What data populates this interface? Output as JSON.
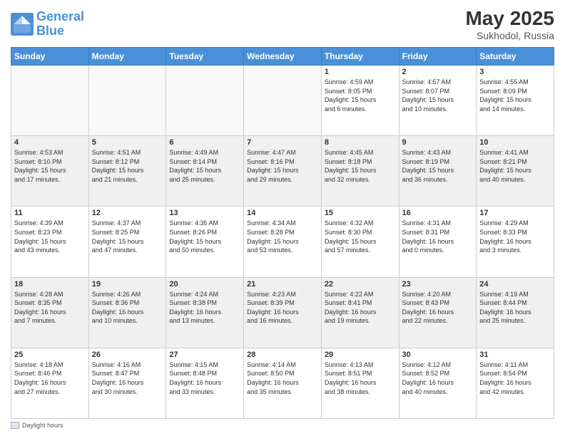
{
  "header": {
    "logo_line1": "General",
    "logo_line2": "Blue",
    "title": "May 2025",
    "subtitle": "Sukhodol, Russia"
  },
  "footer": {
    "label": "Daylight hours"
  },
  "weekdays": [
    "Sunday",
    "Monday",
    "Tuesday",
    "Wednesday",
    "Thursday",
    "Friday",
    "Saturday"
  ],
  "weeks": [
    [
      {
        "day": "",
        "info": ""
      },
      {
        "day": "",
        "info": ""
      },
      {
        "day": "",
        "info": ""
      },
      {
        "day": "",
        "info": ""
      },
      {
        "day": "1",
        "info": "Sunrise: 4:59 AM\nSunset: 8:05 PM\nDaylight: 15 hours\nand 6 minutes."
      },
      {
        "day": "2",
        "info": "Sunrise: 4:57 AM\nSunset: 8:07 PM\nDaylight: 15 hours\nand 10 minutes."
      },
      {
        "day": "3",
        "info": "Sunrise: 4:55 AM\nSunset: 8:09 PM\nDaylight: 15 hours\nand 14 minutes."
      }
    ],
    [
      {
        "day": "4",
        "info": "Sunrise: 4:53 AM\nSunset: 8:10 PM\nDaylight: 15 hours\nand 17 minutes."
      },
      {
        "day": "5",
        "info": "Sunrise: 4:51 AM\nSunset: 8:12 PM\nDaylight: 15 hours\nand 21 minutes."
      },
      {
        "day": "6",
        "info": "Sunrise: 4:49 AM\nSunset: 8:14 PM\nDaylight: 15 hours\nand 25 minutes."
      },
      {
        "day": "7",
        "info": "Sunrise: 4:47 AM\nSunset: 8:16 PM\nDaylight: 15 hours\nand 29 minutes."
      },
      {
        "day": "8",
        "info": "Sunrise: 4:45 AM\nSunset: 8:18 PM\nDaylight: 15 hours\nand 32 minutes."
      },
      {
        "day": "9",
        "info": "Sunrise: 4:43 AM\nSunset: 8:19 PM\nDaylight: 15 hours\nand 36 minutes."
      },
      {
        "day": "10",
        "info": "Sunrise: 4:41 AM\nSunset: 8:21 PM\nDaylight: 15 hours\nand 40 minutes."
      }
    ],
    [
      {
        "day": "11",
        "info": "Sunrise: 4:39 AM\nSunset: 8:23 PM\nDaylight: 15 hours\nand 43 minutes."
      },
      {
        "day": "12",
        "info": "Sunrise: 4:37 AM\nSunset: 8:25 PM\nDaylight: 15 hours\nand 47 minutes."
      },
      {
        "day": "13",
        "info": "Sunrise: 4:36 AM\nSunset: 8:26 PM\nDaylight: 15 hours\nand 50 minutes."
      },
      {
        "day": "14",
        "info": "Sunrise: 4:34 AM\nSunset: 8:28 PM\nDaylight: 15 hours\nand 53 minutes."
      },
      {
        "day": "15",
        "info": "Sunrise: 4:32 AM\nSunset: 8:30 PM\nDaylight: 15 hours\nand 57 minutes."
      },
      {
        "day": "16",
        "info": "Sunrise: 4:31 AM\nSunset: 8:31 PM\nDaylight: 16 hours\nand 0 minutes."
      },
      {
        "day": "17",
        "info": "Sunrise: 4:29 AM\nSunset: 8:33 PM\nDaylight: 16 hours\nand 3 minutes."
      }
    ],
    [
      {
        "day": "18",
        "info": "Sunrise: 4:28 AM\nSunset: 8:35 PM\nDaylight: 16 hours\nand 7 minutes."
      },
      {
        "day": "19",
        "info": "Sunrise: 4:26 AM\nSunset: 8:36 PM\nDaylight: 16 hours\nand 10 minutes."
      },
      {
        "day": "20",
        "info": "Sunrise: 4:24 AM\nSunset: 8:38 PM\nDaylight: 16 hours\nand 13 minutes."
      },
      {
        "day": "21",
        "info": "Sunrise: 4:23 AM\nSunset: 8:39 PM\nDaylight: 16 hours\nand 16 minutes."
      },
      {
        "day": "22",
        "info": "Sunrise: 4:22 AM\nSunset: 8:41 PM\nDaylight: 16 hours\nand 19 minutes."
      },
      {
        "day": "23",
        "info": "Sunrise: 4:20 AM\nSunset: 8:43 PM\nDaylight: 16 hours\nand 22 minutes."
      },
      {
        "day": "24",
        "info": "Sunrise: 4:19 AM\nSunset: 8:44 PM\nDaylight: 16 hours\nand 25 minutes."
      }
    ],
    [
      {
        "day": "25",
        "info": "Sunrise: 4:18 AM\nSunset: 8:46 PM\nDaylight: 16 hours\nand 27 minutes."
      },
      {
        "day": "26",
        "info": "Sunrise: 4:16 AM\nSunset: 8:47 PM\nDaylight: 16 hours\nand 30 minutes."
      },
      {
        "day": "27",
        "info": "Sunrise: 4:15 AM\nSunset: 8:48 PM\nDaylight: 16 hours\nand 33 minutes."
      },
      {
        "day": "28",
        "info": "Sunrise: 4:14 AM\nSunset: 8:50 PM\nDaylight: 16 hours\nand 35 minutes."
      },
      {
        "day": "29",
        "info": "Sunrise: 4:13 AM\nSunset: 8:51 PM\nDaylight: 16 hours\nand 38 minutes."
      },
      {
        "day": "30",
        "info": "Sunrise: 4:12 AM\nSunset: 8:52 PM\nDaylight: 16 hours\nand 40 minutes."
      },
      {
        "day": "31",
        "info": "Sunrise: 4:11 AM\nSunset: 8:54 PM\nDaylight: 16 hours\nand 42 minutes."
      }
    ]
  ]
}
